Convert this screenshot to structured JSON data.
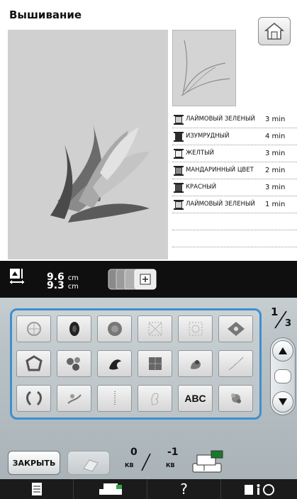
{
  "title": "Вышивание",
  "threads": [
    {
      "name": "Лаймовый зеленый",
      "time": "3 min",
      "color": "#d0d0d0"
    },
    {
      "name": "Изумрудный",
      "time": "4 min",
      "color": "#2a2a2a"
    },
    {
      "name": "Желтый",
      "time": "3 min",
      "color": "#f0f0f0"
    },
    {
      "name": "Мандаринный цвет",
      "time": "2 min",
      "color": "#8a8a8a"
    },
    {
      "name": "Красный",
      "time": "3 min",
      "color": "#4a4a4a"
    },
    {
      "name": "Лаймовый зеленый",
      "time": "1 min",
      "color": "#d0d0d0"
    }
  ],
  "size": {
    "height_value": "9.6",
    "width_value": "9.3",
    "unit": "cm"
  },
  "pagination": {
    "current": "1",
    "total": "3"
  },
  "grid": {
    "cells": [
      {
        "icon": "snowflake-pattern-icon",
        "label": ""
      },
      {
        "icon": "dark-bead-icon",
        "label": ""
      },
      {
        "icon": "floral-circle-icon",
        "label": ""
      },
      {
        "icon": "quilt-square-icon",
        "label": ""
      },
      {
        "icon": "quilt-square-icon-2",
        "label": ""
      },
      {
        "icon": "diamond-ornament-icon",
        "label": ""
      },
      {
        "icon": "wreath-icon",
        "label": ""
      },
      {
        "icon": "flowers-cluster-icon",
        "label": ""
      },
      {
        "icon": "dragon-icon",
        "label": ""
      },
      {
        "icon": "lace-pattern-icon",
        "label": ""
      },
      {
        "icon": "shell-icon",
        "label": ""
      },
      {
        "icon": "leaf-branch-icon",
        "label": ""
      },
      {
        "icon": "laurel-wreath-icon",
        "label": ""
      },
      {
        "icon": "bird-flowers-icon",
        "label": ""
      },
      {
        "icon": "text-vertical-icon",
        "label": ""
      },
      {
        "icon": "swan-icon",
        "label": ""
      },
      {
        "icon": "abc-letters-icon",
        "label": "ABC"
      },
      {
        "icon": "flower-small-icon",
        "label": ""
      }
    ]
  },
  "buttons": {
    "close": "ЗАКРЫТЬ"
  },
  "counters": {
    "kb_a_value": "0",
    "kb_b_value": "-1",
    "unit": "КВ"
  },
  "tabs": [
    {
      "icon": "document-icon",
      "label": ""
    },
    {
      "icon": "embroidery-unit-icon",
      "label": ""
    },
    {
      "icon": "help-icon",
      "label": "?"
    },
    {
      "icon": "settings-info-icon",
      "label": ""
    }
  ],
  "colors": {
    "accent": "#3f8fcf",
    "panel": "#b9c2c6",
    "preview_bg": "#d0d0d0"
  }
}
